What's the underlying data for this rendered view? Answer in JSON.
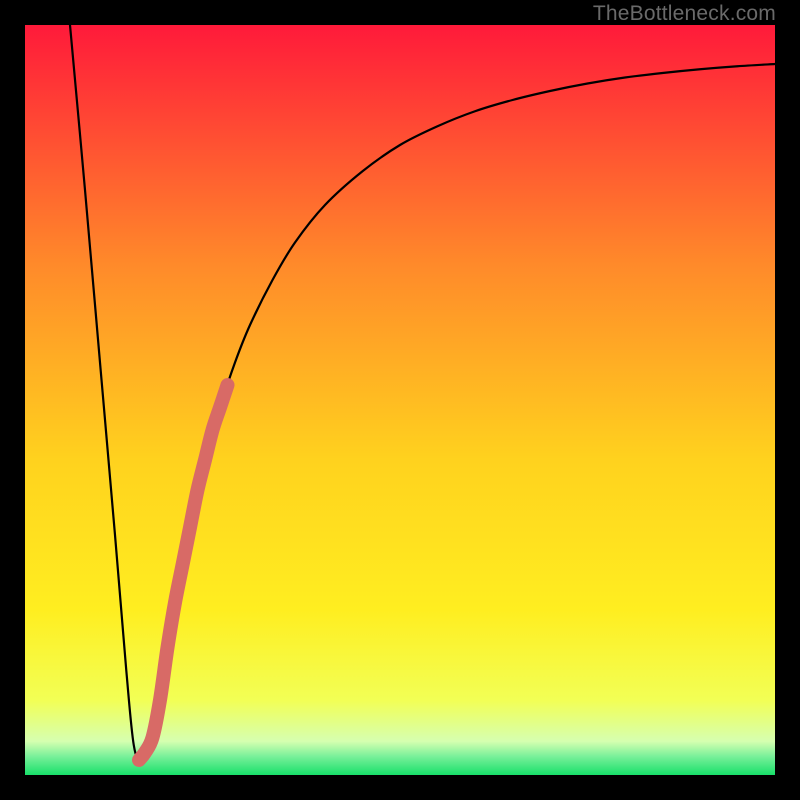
{
  "watermark": "TheBottleneck.com",
  "chart_data": {
    "type": "line",
    "title": "",
    "xlabel": "",
    "ylabel": "",
    "xlim": [
      0,
      100
    ],
    "ylim": [
      0,
      100
    ],
    "grid": false,
    "background_gradient": {
      "top_color": "#ff1a3a",
      "mid_top_color": "#ff9a1f",
      "mid_color": "#ffe61e",
      "low_band_color": "#f6ff6e",
      "bottom_color": "#18e06a"
    },
    "series": [
      {
        "name": "bottleneck-curve",
        "stroke": "#000000",
        "x": [
          6,
          8,
          10,
          12,
          13.5,
          14.5,
          15.5,
          17,
          18,
          19,
          20,
          22,
          24,
          26,
          28,
          30,
          33,
          36,
          40,
          45,
          50,
          55,
          60,
          65,
          70,
          75,
          80,
          85,
          90,
          95,
          100
        ],
        "y": [
          100,
          78,
          55,
          32,
          14,
          4,
          2,
          4,
          10,
          17,
          23,
          33,
          42,
          49,
          55,
          60,
          66,
          71,
          76,
          80.5,
          84,
          86.5,
          88.5,
          90,
          91.2,
          92.2,
          93,
          93.6,
          94.1,
          94.5,
          94.8
        ]
      },
      {
        "name": "highlight-segment",
        "stroke": "#d86a66",
        "thick": true,
        "x": [
          15.2,
          16,
          17,
          18,
          19,
          20,
          21,
          22,
          23,
          24,
          25,
          26,
          27
        ],
        "y": [
          2,
          3,
          5,
          10,
          17,
          23,
          28,
          33,
          38,
          42,
          46,
          49,
          52
        ]
      }
    ]
  }
}
